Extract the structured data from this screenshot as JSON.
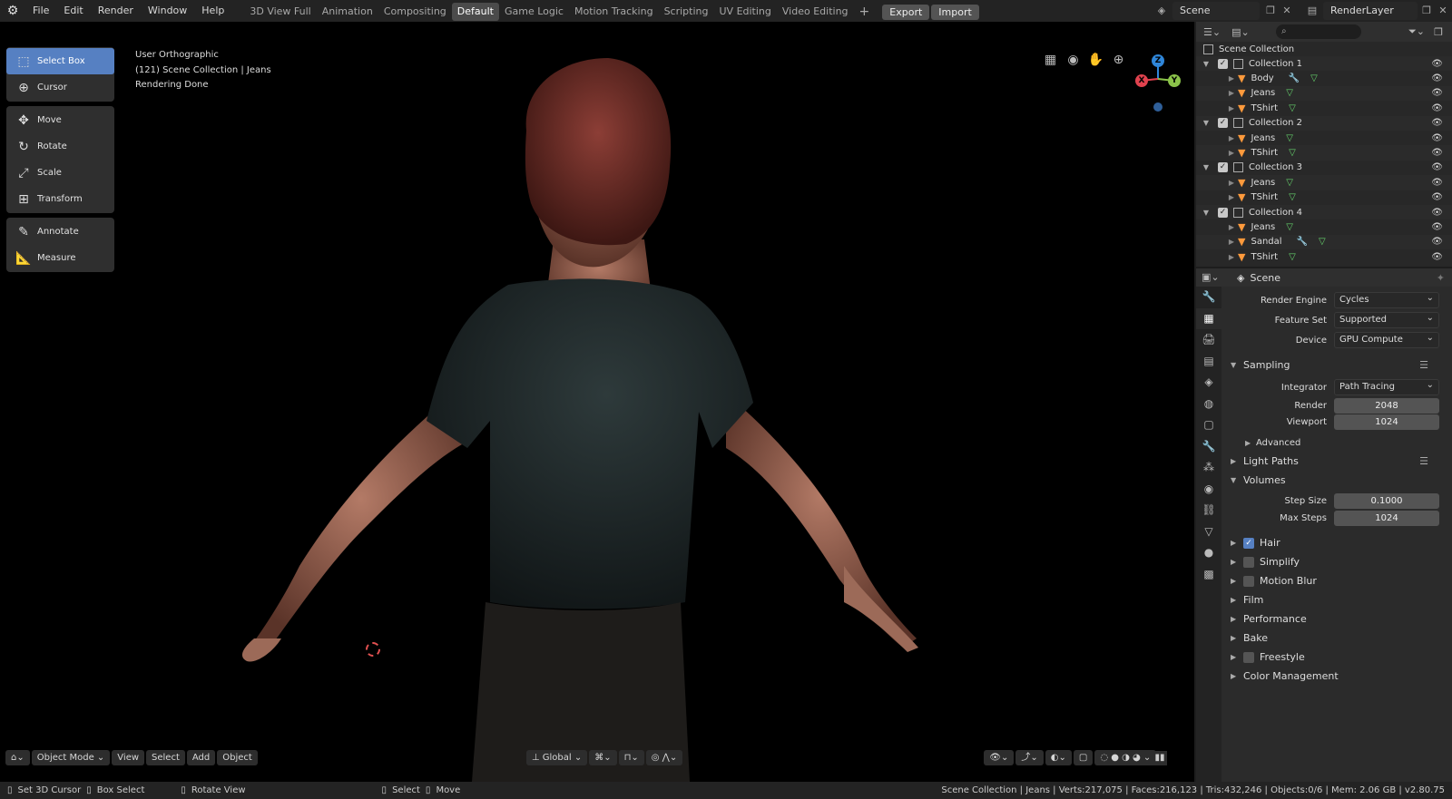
{
  "menu": [
    "File",
    "Edit",
    "Render",
    "Window",
    "Help"
  ],
  "workspaces": [
    "3D View Full",
    "Animation",
    "Compositing",
    "Default",
    "Game Logic",
    "Motion Tracking",
    "Scripting",
    "UV Editing",
    "Video Editing"
  ],
  "active_workspace": "Default",
  "export_label": "Export",
  "import_label": "Import",
  "scene_name": "Scene",
  "render_layer": "RenderLayer",
  "tools": {
    "select_box": "Select Box",
    "cursor": "Cursor",
    "move": "Move",
    "rotate": "Rotate",
    "scale": "Scale",
    "transform": "Transform",
    "annotate": "Annotate",
    "measure": "Measure"
  },
  "viewport": {
    "view_name": "User Orthographic",
    "collection": "(121) Scene Collection | Jeans",
    "status": "Rendering Done"
  },
  "gizmo": {
    "x": "X",
    "y": "Y",
    "z": "Z"
  },
  "vpheader": {
    "mode": "Object Mode",
    "view": "View",
    "select": "Select",
    "add": "Add",
    "object": "Object",
    "orientation": "Global"
  },
  "outliner": {
    "root": "Scene Collection",
    "rows": [
      {
        "name": "Collection 1",
        "type": "collection"
      },
      {
        "name": "Body",
        "type": "object",
        "modifier": true
      },
      {
        "name": "Jeans",
        "type": "object"
      },
      {
        "name": "TShirt",
        "type": "object"
      },
      {
        "name": "Collection 2",
        "type": "collection"
      },
      {
        "name": "Jeans",
        "type": "object"
      },
      {
        "name": "TShirt",
        "type": "object"
      },
      {
        "name": "Collection 3",
        "type": "collection"
      },
      {
        "name": "Jeans",
        "type": "object"
      },
      {
        "name": "TShirt",
        "type": "object"
      },
      {
        "name": "Collection 4",
        "type": "collection"
      },
      {
        "name": "Jeans",
        "type": "object"
      },
      {
        "name": "Sandal",
        "type": "object",
        "modifier": true
      },
      {
        "name": "TShirt",
        "type": "object"
      }
    ]
  },
  "properties": {
    "context": "Scene",
    "render_engine_label": "Render Engine",
    "render_engine": "Cycles",
    "feature_set_label": "Feature Set",
    "feature_set": "Supported",
    "device_label": "Device",
    "device": "GPU Compute",
    "sampling": "Sampling",
    "integrator_label": "Integrator",
    "integrator": "Path Tracing",
    "render_label": "Render",
    "render_samples": "2048",
    "viewport_label": "Viewport",
    "viewport_samples": "1024",
    "advanced": "Advanced",
    "light_paths": "Light Paths",
    "volumes": "Volumes",
    "step_size_label": "Step Size",
    "step_size": "0.1000",
    "max_steps_label": "Max Steps",
    "max_steps": "1024",
    "hair": "Hair",
    "simplify": "Simplify",
    "motion_blur": "Motion Blur",
    "film": "Film",
    "performance": "Performance",
    "bake": "Bake",
    "freestyle": "Freestyle",
    "color_management": "Color Management"
  },
  "statusbar": {
    "set_cursor": "Set 3D Cursor",
    "box_select": "Box Select",
    "rotate_view": "Rotate View",
    "select": "Select",
    "move": "Move",
    "stats": "Scene Collection | Jeans | Verts:217,075 | Faces:216,123 | Tris:432,246 | Objects:0/6 | Mem: 2.06 GB | v2.80.75"
  },
  "colors": {
    "accent": "#5680c2",
    "x_axis": "#e0424e",
    "y_axis": "#8bc34a",
    "z_axis": "#2f86d9",
    "object_orange": "#ff9a3c",
    "vertex_green": "#66d46c"
  }
}
